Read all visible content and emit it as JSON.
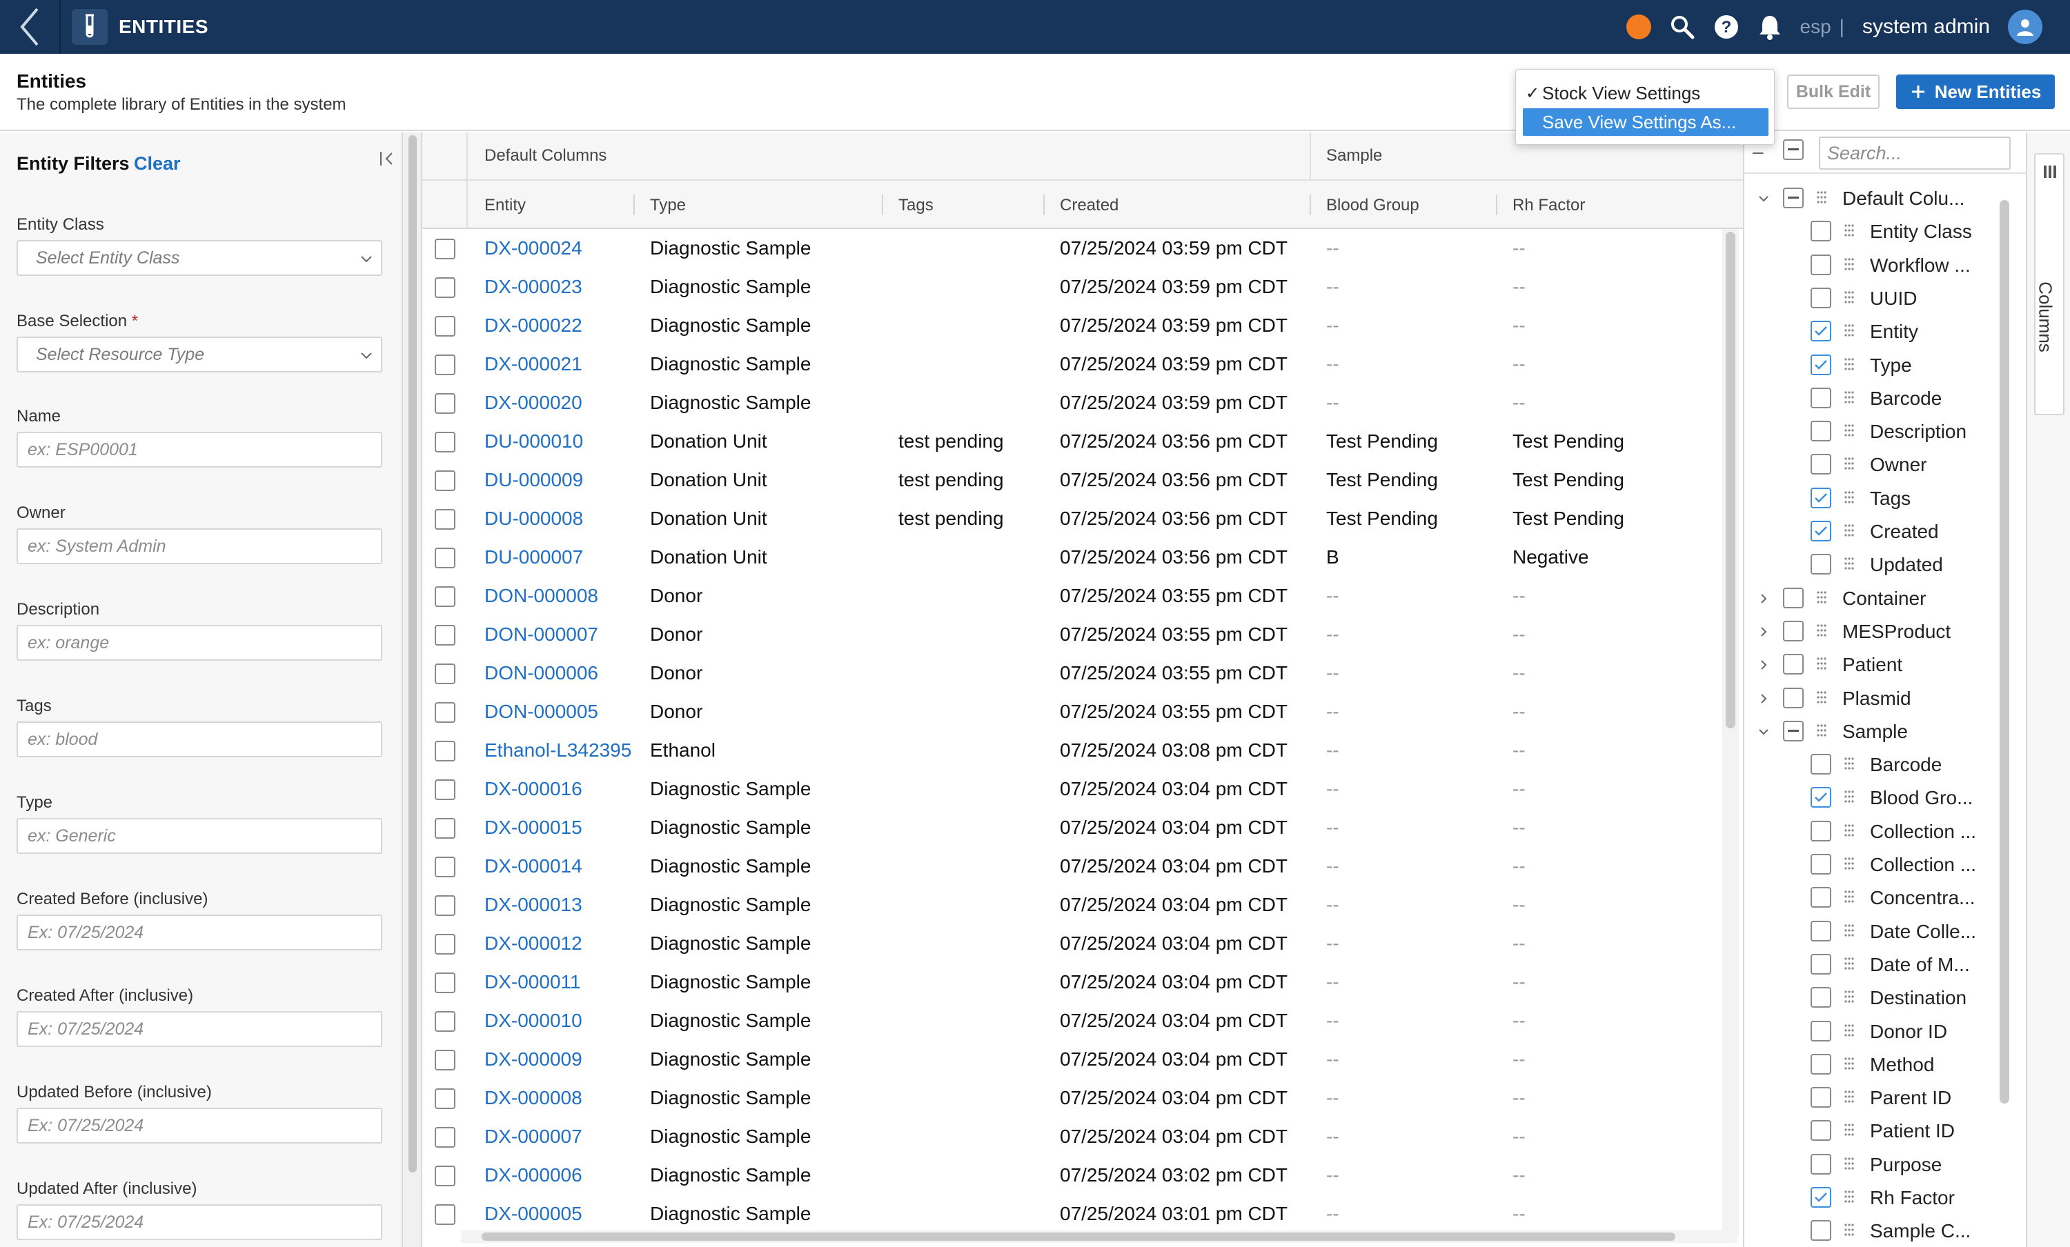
{
  "app": {
    "title": "ENTITIES",
    "env_label": "esp",
    "user_name": "system admin"
  },
  "header": {
    "title": "Entities",
    "subtitle": "The complete library of Entities in the system",
    "bulk_edit_label": "Bulk Edit",
    "new_entities_label": "New Entities"
  },
  "view_menu": {
    "stock_label": "Stock View Settings",
    "save_as_label": "Save View Settings As..."
  },
  "filters": {
    "title": "Entity Filters",
    "clear_label": "Clear",
    "entity_class": {
      "label": "Entity Class",
      "placeholder": "Select Entity Class"
    },
    "base_selection": {
      "label": "Base Selection",
      "required_mark": "*",
      "placeholder": "Select Resource Type"
    },
    "name": {
      "label": "Name",
      "placeholder": "ex: ESP00001"
    },
    "owner": {
      "label": "Owner",
      "placeholder": "ex: System Admin"
    },
    "description": {
      "label": "Description",
      "placeholder": "ex: orange"
    },
    "tags": {
      "label": "Tags",
      "placeholder": "ex: blood"
    },
    "type": {
      "label": "Type",
      "placeholder": "ex: Generic"
    },
    "created_before": {
      "label": "Created Before (inclusive)",
      "placeholder": "Ex: 07/25/2024"
    },
    "created_after": {
      "label": "Created After (inclusive)",
      "placeholder": "Ex: 07/25/2024"
    },
    "updated_before": {
      "label": "Updated Before (inclusive)",
      "placeholder": "Ex: 07/25/2024"
    },
    "updated_after": {
      "label": "Updated After (inclusive)",
      "placeholder": "Ex: 07/25/2024"
    }
  },
  "grid": {
    "groups": [
      "Default Columns",
      "Sample"
    ],
    "columns": [
      "Entity",
      "Type",
      "Tags",
      "Created",
      "Blood Group",
      "Rh Factor"
    ],
    "rows": [
      [
        "DX-000024",
        "Diagnostic Sample",
        "",
        "07/25/2024 03:59 pm CDT",
        "--",
        "--"
      ],
      [
        "DX-000023",
        "Diagnostic Sample",
        "",
        "07/25/2024 03:59 pm CDT",
        "--",
        "--"
      ],
      [
        "DX-000022",
        "Diagnostic Sample",
        "",
        "07/25/2024 03:59 pm CDT",
        "--",
        "--"
      ],
      [
        "DX-000021",
        "Diagnostic Sample",
        "",
        "07/25/2024 03:59 pm CDT",
        "--",
        "--"
      ],
      [
        "DX-000020",
        "Diagnostic Sample",
        "",
        "07/25/2024 03:59 pm CDT",
        "--",
        "--"
      ],
      [
        "DU-000010",
        "Donation Unit",
        "test pending",
        "07/25/2024 03:56 pm CDT",
        "Test Pending",
        "Test Pending"
      ],
      [
        "DU-000009",
        "Donation Unit",
        "test pending",
        "07/25/2024 03:56 pm CDT",
        "Test Pending",
        "Test Pending"
      ],
      [
        "DU-000008",
        "Donation Unit",
        "test pending",
        "07/25/2024 03:56 pm CDT",
        "Test Pending",
        "Test Pending"
      ],
      [
        "DU-000007",
        "Donation Unit",
        "",
        "07/25/2024 03:56 pm CDT",
        "B",
        "Negative"
      ],
      [
        "DON-000008",
        "Donor",
        "",
        "07/25/2024 03:55 pm CDT",
        "--",
        "--"
      ],
      [
        "DON-000007",
        "Donor",
        "",
        "07/25/2024 03:55 pm CDT",
        "--",
        "--"
      ],
      [
        "DON-000006",
        "Donor",
        "",
        "07/25/2024 03:55 pm CDT",
        "--",
        "--"
      ],
      [
        "DON-000005",
        "Donor",
        "",
        "07/25/2024 03:55 pm CDT",
        "--",
        "--"
      ],
      [
        "Ethanol-L342395",
        "Ethanol",
        "",
        "07/25/2024 03:08 pm CDT",
        "--",
        "--"
      ],
      [
        "DX-000016",
        "Diagnostic Sample",
        "",
        "07/25/2024 03:04 pm CDT",
        "--",
        "--"
      ],
      [
        "DX-000015",
        "Diagnostic Sample",
        "",
        "07/25/2024 03:04 pm CDT",
        "--",
        "--"
      ],
      [
        "DX-000014",
        "Diagnostic Sample",
        "",
        "07/25/2024 03:04 pm CDT",
        "--",
        "--"
      ],
      [
        "DX-000013",
        "Diagnostic Sample",
        "",
        "07/25/2024 03:04 pm CDT",
        "--",
        "--"
      ],
      [
        "DX-000012",
        "Diagnostic Sample",
        "",
        "07/25/2024 03:04 pm CDT",
        "--",
        "--"
      ],
      [
        "DX-000011",
        "Diagnostic Sample",
        "",
        "07/25/2024 03:04 pm CDT",
        "--",
        "--"
      ],
      [
        "DX-000010",
        "Diagnostic Sample",
        "",
        "07/25/2024 03:04 pm CDT",
        "--",
        "--"
      ],
      [
        "DX-000009",
        "Diagnostic Sample",
        "",
        "07/25/2024 03:04 pm CDT",
        "--",
        "--"
      ],
      [
        "DX-000008",
        "Diagnostic Sample",
        "",
        "07/25/2024 03:04 pm CDT",
        "--",
        "--"
      ],
      [
        "DX-000007",
        "Diagnostic Sample",
        "",
        "07/25/2024 03:04 pm CDT",
        "--",
        "--"
      ],
      [
        "DX-000006",
        "Diagnostic Sample",
        "",
        "07/25/2024 03:02 pm CDT",
        "--",
        "--"
      ],
      [
        "DX-000005",
        "Diagnostic Sample",
        "",
        "07/25/2024 03:01 pm CDT",
        "--",
        "--"
      ]
    ]
  },
  "columns_panel": {
    "search_placeholder": "Search...",
    "tab_label": "Columns",
    "tree": [
      {
        "label": "Default Colu...",
        "level": 0,
        "expand": "open",
        "check": "partial"
      },
      {
        "label": "Entity Class",
        "level": 1,
        "check": "off"
      },
      {
        "label": "Workflow ...",
        "level": 1,
        "check": "off"
      },
      {
        "label": "UUID",
        "level": 1,
        "check": "off"
      },
      {
        "label": "Entity",
        "level": 1,
        "check": "on"
      },
      {
        "label": "Type",
        "level": 1,
        "check": "on"
      },
      {
        "label": "Barcode",
        "level": 1,
        "check": "off"
      },
      {
        "label": "Description",
        "level": 1,
        "check": "off"
      },
      {
        "label": "Owner",
        "level": 1,
        "check": "off"
      },
      {
        "label": "Tags",
        "level": 1,
        "check": "on"
      },
      {
        "label": "Created",
        "level": 1,
        "check": "on"
      },
      {
        "label": "Updated",
        "level": 1,
        "check": "off"
      },
      {
        "label": "Container",
        "level": 0,
        "expand": "closed",
        "check": "off"
      },
      {
        "label": "MESProduct",
        "level": 0,
        "expand": "closed",
        "check": "off"
      },
      {
        "label": "Patient",
        "level": 0,
        "expand": "closed",
        "check": "off"
      },
      {
        "label": "Plasmid",
        "level": 0,
        "expand": "closed",
        "check": "off"
      },
      {
        "label": "Sample",
        "level": 0,
        "expand": "open",
        "check": "partial"
      },
      {
        "label": "Barcode",
        "level": 1,
        "check": "off"
      },
      {
        "label": "Blood Gro...",
        "level": 1,
        "check": "on"
      },
      {
        "label": "Collection ...",
        "level": 1,
        "check": "off"
      },
      {
        "label": "Collection ...",
        "level": 1,
        "check": "off"
      },
      {
        "label": "Concentra...",
        "level": 1,
        "check": "off"
      },
      {
        "label": "Date Colle...",
        "level": 1,
        "check": "off"
      },
      {
        "label": "Date of M...",
        "level": 1,
        "check": "off"
      },
      {
        "label": "Destination",
        "level": 1,
        "check": "off"
      },
      {
        "label": "Donor ID",
        "level": 1,
        "check": "off"
      },
      {
        "label": "Method",
        "level": 1,
        "check": "off"
      },
      {
        "label": "Parent ID",
        "level": 1,
        "check": "off"
      },
      {
        "label": "Patient ID",
        "level": 1,
        "check": "off"
      },
      {
        "label": "Purpose",
        "level": 1,
        "check": "off"
      },
      {
        "label": "Rh Factor",
        "level": 1,
        "check": "on"
      },
      {
        "label": "Sample C...",
        "level": 1,
        "check": "off"
      }
    ]
  },
  "colors": {
    "nav": "#17345a",
    "accent": "#1f6fc5",
    "status_dot": "#f47c20",
    "menu_highlight": "#3b8fe0"
  },
  "icons": [
    "back-chevron-icon",
    "test-tube-icon",
    "search-icon",
    "help-icon",
    "bell-icon",
    "user-icon",
    "plus-icon",
    "checkmark-icon",
    "collapse-panel-icon",
    "chevron-down-icon",
    "chevron-right-icon",
    "drag-grip-icon",
    "columns-icon"
  ]
}
